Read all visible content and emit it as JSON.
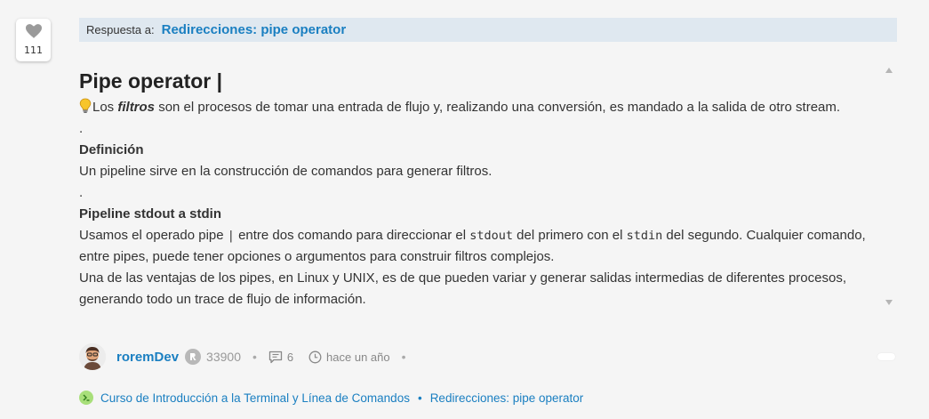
{
  "likes": {
    "count": "111"
  },
  "reply": {
    "label": "Respuesta a:",
    "link": "Redirecciones: pipe operator"
  },
  "post": {
    "title": "Pipe operator |",
    "intro_before": "Los ",
    "intro_em": "filtros",
    "intro_after": " son el procesos de tomar una entrada de flujo y, realizando una conversión, es mandado a la salida de otro stream.",
    "dot1": ".",
    "def_heading": "Definición",
    "def_text": "Un pipeline sirve en la construcción de comandos para generar filtros.",
    "dot2": ".",
    "pipe_heading": "Pipeline stdout a stdin",
    "p1_a": "Usamos el operado pipe ",
    "p1_code1": "|",
    "p1_b": " entre dos comando para direccionar el ",
    "p1_code2": "stdout",
    "p1_c": " del primero con el ",
    "p1_code3": "stdin",
    "p1_d": " del segundo. Cualquier comando, entre pipes, puede tener opciones o argumentos para construir filtros complejos.",
    "p2": "Una de las ventajas de los pipes, en Linux y UNIX, es de que pueden variar y generar salidas intermedias de diferentes procesos, generando todo un trace de flujo de información."
  },
  "author": {
    "name": "roremDev",
    "points": "33900",
    "replies": "6",
    "time": "hace un año",
    "separator": "•"
  },
  "breadcrumbs": {
    "course": "Curso de Introducción a la Terminal y Línea de Comandos",
    "separator": "•",
    "lesson": "Redirecciones: pipe operator"
  },
  "colors": {
    "accent": "#1a7fc1",
    "reply_bg": "#dfe8f0",
    "page_bg": "#f5f5f5"
  }
}
